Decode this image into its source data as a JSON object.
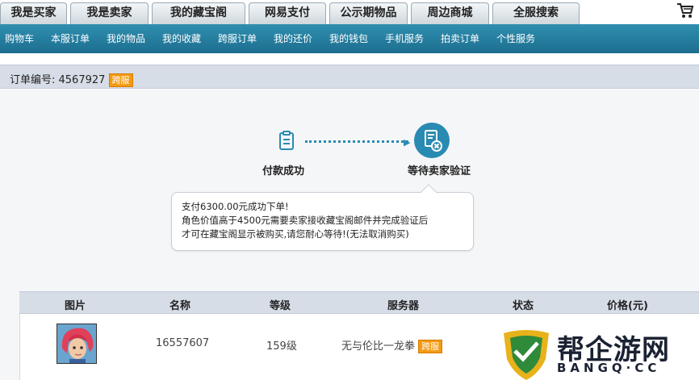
{
  "top_tabs": [
    "我是买家",
    "我是卖家",
    "我的藏宝阁",
    "网易支付",
    "公示期物品",
    "周边商城",
    "全服搜索"
  ],
  "nav_items": [
    "购物车",
    "本服订单",
    "我的物品",
    "我的收藏",
    "跨服订单",
    "我的还价",
    "我的钱包",
    "手机服务",
    "拍卖订单",
    "个性服务"
  ],
  "order": {
    "label": "订单编号: 4567927",
    "badge": "跨服"
  },
  "progress": {
    "step1": "付款成功",
    "step2": "等待卖家验证"
  },
  "tip": {
    "line1": "支付6300.00元成功下单!",
    "line2": "角色价值高于4500元需要卖家接收藏宝阁邮件并完成验证后",
    "line3": "才可在藏宝阁显示被购买,请您耐心等待!(无法取消购买)"
  },
  "table": {
    "headers": [
      "图片",
      "名称",
      "等级",
      "服务器",
      "状态",
      "价格(元)"
    ],
    "row": {
      "name": "16557607",
      "level": "159级",
      "server": "无与伦比一龙拳",
      "server_badge": "跨服"
    }
  },
  "watermark": {
    "text": "帮企游网",
    "sub": "BANGQ·CC"
  },
  "colors": {
    "nav": "#2a7fa3",
    "accent": "#2a8bb2",
    "badge": "#f39a12",
    "header_bg": "#d7dde7"
  },
  "icons": {
    "cart": "cart-icon",
    "step1": "clipboard-icon",
    "step2": "document-cancel-icon",
    "watermark": "shield-logo-icon"
  }
}
